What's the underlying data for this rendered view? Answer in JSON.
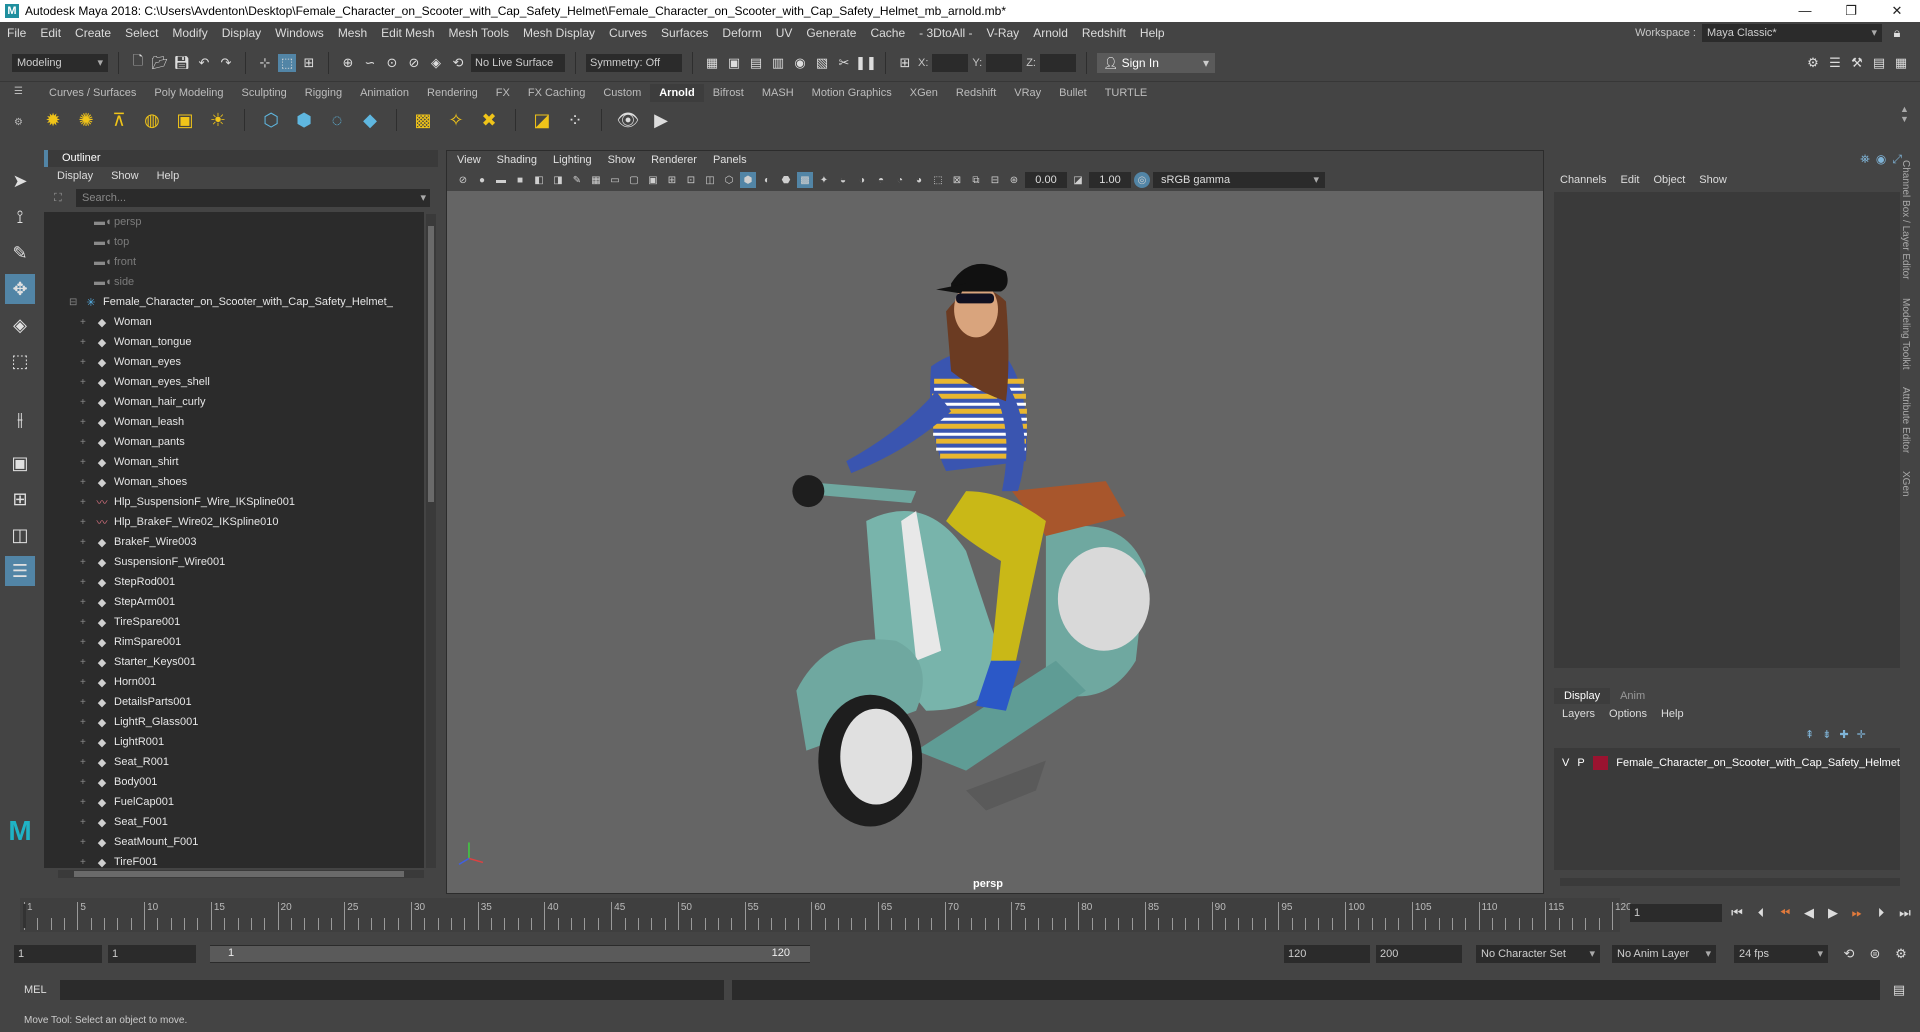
{
  "title": "Autodesk Maya 2018: C:\\Users\\Avdenton\\Desktop\\Female_Character_on_Scooter_with_Cap_Safety_Helmet\\Female_Character_on_Scooter_with_Cap_Safety_Helmet_mb_arnold.mb*",
  "window_buttons": [
    "—",
    "❐",
    "✕"
  ],
  "menu": [
    "File",
    "Edit",
    "Create",
    "Select",
    "Modify",
    "Display",
    "Windows",
    "Mesh",
    "Edit Mesh",
    "Mesh Tools",
    "Mesh Display",
    "Curves",
    "Surfaces",
    "Deform",
    "UV",
    "Generate",
    "Cache",
    "- 3DtoAll -",
    "V-Ray",
    "Arnold",
    "Redshift",
    "Help"
  ],
  "workspace": {
    "label": "Workspace :",
    "value": "Maya Classic*"
  },
  "status_line": {
    "mode": "Modeling",
    "live_surface": "No Live Surface",
    "symmetry": "Symmetry: Off",
    "x_label": "X:",
    "y_label": "Y:",
    "z_label": "Z:",
    "sign_in": "Sign In"
  },
  "shelf_tabs": [
    "Curves / Surfaces",
    "Poly Modeling",
    "Sculpting",
    "Rigging",
    "Animation",
    "Rendering",
    "FX",
    "FX Caching",
    "Custom",
    "Arnold",
    "Bifrost",
    "MASH",
    "Motion Graphics",
    "XGen",
    "Redshift",
    "VRay",
    "Bullet",
    "TURTLE"
  ],
  "shelf_active": "Arnold",
  "outliner": {
    "title": "Outliner",
    "menu": [
      "Display",
      "Show",
      "Help"
    ],
    "search_placeholder": "Search...",
    "items": [
      {
        "label": "persp",
        "type": "cam"
      },
      {
        "label": "top",
        "type": "cam"
      },
      {
        "label": "front",
        "type": "cam"
      },
      {
        "label": "side",
        "type": "cam"
      },
      {
        "label": "Female_Character_on_Scooter_with_Cap_Safety_Helmet_",
        "type": "group"
      },
      {
        "label": "Woman",
        "type": "mesh"
      },
      {
        "label": "Woman_tongue",
        "type": "mesh"
      },
      {
        "label": "Woman_eyes",
        "type": "mesh"
      },
      {
        "label": "Woman_eyes_shell",
        "type": "mesh"
      },
      {
        "label": "Woman_hair_curly",
        "type": "mesh"
      },
      {
        "label": "Woman_leash",
        "type": "mesh"
      },
      {
        "label": "Woman_pants",
        "type": "mesh"
      },
      {
        "label": "Woman_shirt",
        "type": "mesh"
      },
      {
        "label": "Woman_shoes",
        "type": "mesh"
      },
      {
        "label": "Hlp_SuspensionF_Wire_IKSpline001",
        "type": "curve"
      },
      {
        "label": "Hlp_BrakeF_Wire02_IKSpline010",
        "type": "curve"
      },
      {
        "label": "BrakeF_Wire003",
        "type": "mesh"
      },
      {
        "label": "SuspensionF_Wire001",
        "type": "mesh"
      },
      {
        "label": "StepRod001",
        "type": "mesh"
      },
      {
        "label": "StepArm001",
        "type": "mesh"
      },
      {
        "label": "TireSpare001",
        "type": "mesh"
      },
      {
        "label": "RimSpare001",
        "type": "mesh"
      },
      {
        "label": "Starter_Keys001",
        "type": "mesh"
      },
      {
        "label": "Horn001",
        "type": "mesh"
      },
      {
        "label": "DetailsParts001",
        "type": "mesh"
      },
      {
        "label": "LightR_Glass001",
        "type": "mesh"
      },
      {
        "label": "LightR001",
        "type": "mesh"
      },
      {
        "label": "Seat_R001",
        "type": "mesh"
      },
      {
        "label": "Body001",
        "type": "mesh"
      },
      {
        "label": "FuelCap001",
        "type": "mesh"
      },
      {
        "label": "Seat_F001",
        "type": "mesh"
      },
      {
        "label": "SeatMount_F001",
        "type": "mesh"
      },
      {
        "label": "TireF001",
        "type": "mesh"
      }
    ]
  },
  "viewport": {
    "menu": [
      "View",
      "Shading",
      "Lighting",
      "Show",
      "Renderer",
      "Panels"
    ],
    "exposure": "0.00",
    "gamma": "1.00",
    "color_space": "sRGB gamma",
    "camera": "persp"
  },
  "channel_box": {
    "menu": [
      "Channels",
      "Edit",
      "Object",
      "Show"
    ],
    "tabs": [
      "Display",
      "Anim"
    ],
    "layer_menu": [
      "Layers",
      "Options",
      "Help"
    ],
    "layer": {
      "v": "V",
      "p": "P",
      "name": "Female_Character_on_Scooter_with_Cap_Safety_Helmet",
      "color": "#9a1330"
    }
  },
  "side_tabs": [
    "Channel Box / Layer Editor",
    "Modeling Toolkit",
    "Attribute Editor",
    "XGen"
  ],
  "time_slider": {
    "ticks": [
      "1",
      "5",
      "10",
      "15",
      "20",
      "25",
      "30",
      "35",
      "40",
      "45",
      "50",
      "55",
      "60",
      "65",
      "70",
      "75",
      "80",
      "85",
      "90",
      "95",
      "100",
      "105",
      "110",
      "115",
      "120"
    ],
    "current_frame": "1"
  },
  "range": {
    "start": "1",
    "playback_start": "1",
    "slider_start": "1",
    "slider_end": "120",
    "playback_end": "120",
    "end": "200",
    "character_set": "No Character Set",
    "anim_layer": "No Anim Layer",
    "fps": "24 fps"
  },
  "command_line": {
    "label": "MEL"
  },
  "help_line": "Move Tool: Select an object to move.",
  "colors": {
    "accent": "#5285a6",
    "bg": "#444444",
    "panel": "#2b2b2b",
    "viewport": "#656565"
  }
}
